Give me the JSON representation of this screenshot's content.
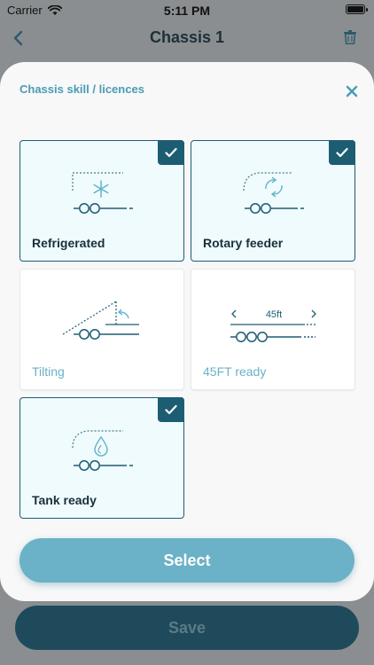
{
  "status_bar": {
    "carrier": "Carrier",
    "time": "5:11 PM"
  },
  "nav": {
    "title": "Chassis 1"
  },
  "sheet": {
    "title": "Chassis skill / licences",
    "select_label": "Select"
  },
  "cards": [
    {
      "label": "Refrigerated",
      "selected": true,
      "icon": "refrigerated-icon"
    },
    {
      "label": "Rotary feeder",
      "selected": true,
      "icon": "rotary-feeder-icon"
    },
    {
      "label": "Tilting",
      "selected": false,
      "icon": "tilting-icon"
    },
    {
      "label": "45FT ready",
      "selected": false,
      "icon": "45ft-icon",
      "icon_text": "45ft"
    },
    {
      "label": "Tank ready",
      "selected": true,
      "icon": "tank-icon"
    }
  ],
  "footer": {
    "save_label": "Save"
  },
  "colors": {
    "accent": "#6bb1c7",
    "dark_teal": "#1d5d74",
    "label_light": "#6ab1c7"
  }
}
